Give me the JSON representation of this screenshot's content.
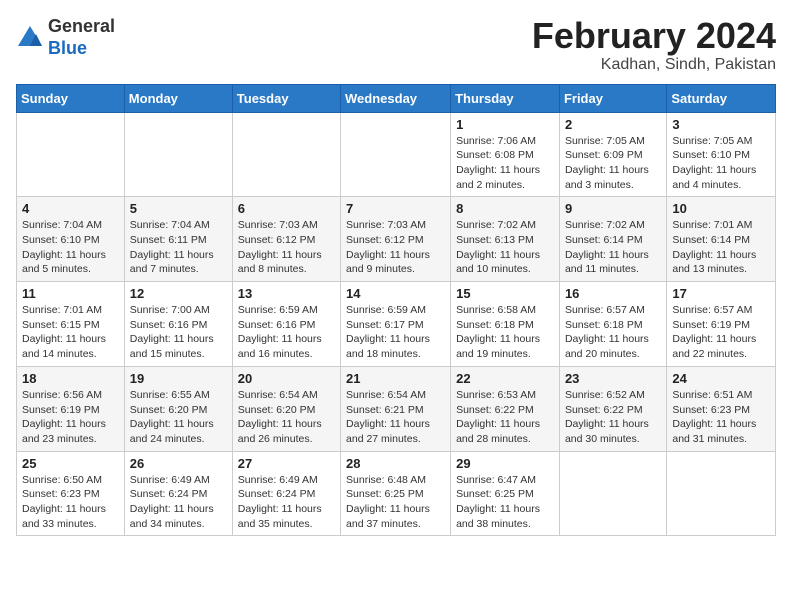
{
  "header": {
    "logo_general": "General",
    "logo_blue": "Blue",
    "month_title": "February 2024",
    "location": "Kadhan, Sindh, Pakistan"
  },
  "weekdays": [
    "Sunday",
    "Monday",
    "Tuesday",
    "Wednesday",
    "Thursday",
    "Friday",
    "Saturday"
  ],
  "weeks": [
    [
      {
        "day": "",
        "info": ""
      },
      {
        "day": "",
        "info": ""
      },
      {
        "day": "",
        "info": ""
      },
      {
        "day": "",
        "info": ""
      },
      {
        "day": "1",
        "info": "Sunrise: 7:06 AM\nSunset: 6:08 PM\nDaylight: 11 hours\nand 2 minutes."
      },
      {
        "day": "2",
        "info": "Sunrise: 7:05 AM\nSunset: 6:09 PM\nDaylight: 11 hours\nand 3 minutes."
      },
      {
        "day": "3",
        "info": "Sunrise: 7:05 AM\nSunset: 6:10 PM\nDaylight: 11 hours\nand 4 minutes."
      }
    ],
    [
      {
        "day": "4",
        "info": "Sunrise: 7:04 AM\nSunset: 6:10 PM\nDaylight: 11 hours\nand 5 minutes."
      },
      {
        "day": "5",
        "info": "Sunrise: 7:04 AM\nSunset: 6:11 PM\nDaylight: 11 hours\nand 7 minutes."
      },
      {
        "day": "6",
        "info": "Sunrise: 7:03 AM\nSunset: 6:12 PM\nDaylight: 11 hours\nand 8 minutes."
      },
      {
        "day": "7",
        "info": "Sunrise: 7:03 AM\nSunset: 6:12 PM\nDaylight: 11 hours\nand 9 minutes."
      },
      {
        "day": "8",
        "info": "Sunrise: 7:02 AM\nSunset: 6:13 PM\nDaylight: 11 hours\nand 10 minutes."
      },
      {
        "day": "9",
        "info": "Sunrise: 7:02 AM\nSunset: 6:14 PM\nDaylight: 11 hours\nand 11 minutes."
      },
      {
        "day": "10",
        "info": "Sunrise: 7:01 AM\nSunset: 6:14 PM\nDaylight: 11 hours\nand 13 minutes."
      }
    ],
    [
      {
        "day": "11",
        "info": "Sunrise: 7:01 AM\nSunset: 6:15 PM\nDaylight: 11 hours\nand 14 minutes."
      },
      {
        "day": "12",
        "info": "Sunrise: 7:00 AM\nSunset: 6:16 PM\nDaylight: 11 hours\nand 15 minutes."
      },
      {
        "day": "13",
        "info": "Sunrise: 6:59 AM\nSunset: 6:16 PM\nDaylight: 11 hours\nand 16 minutes."
      },
      {
        "day": "14",
        "info": "Sunrise: 6:59 AM\nSunset: 6:17 PM\nDaylight: 11 hours\nand 18 minutes."
      },
      {
        "day": "15",
        "info": "Sunrise: 6:58 AM\nSunset: 6:18 PM\nDaylight: 11 hours\nand 19 minutes."
      },
      {
        "day": "16",
        "info": "Sunrise: 6:57 AM\nSunset: 6:18 PM\nDaylight: 11 hours\nand 20 minutes."
      },
      {
        "day": "17",
        "info": "Sunrise: 6:57 AM\nSunset: 6:19 PM\nDaylight: 11 hours\nand 22 minutes."
      }
    ],
    [
      {
        "day": "18",
        "info": "Sunrise: 6:56 AM\nSunset: 6:19 PM\nDaylight: 11 hours\nand 23 minutes."
      },
      {
        "day": "19",
        "info": "Sunrise: 6:55 AM\nSunset: 6:20 PM\nDaylight: 11 hours\nand 24 minutes."
      },
      {
        "day": "20",
        "info": "Sunrise: 6:54 AM\nSunset: 6:20 PM\nDaylight: 11 hours\nand 26 minutes."
      },
      {
        "day": "21",
        "info": "Sunrise: 6:54 AM\nSunset: 6:21 PM\nDaylight: 11 hours\nand 27 minutes."
      },
      {
        "day": "22",
        "info": "Sunrise: 6:53 AM\nSunset: 6:22 PM\nDaylight: 11 hours\nand 28 minutes."
      },
      {
        "day": "23",
        "info": "Sunrise: 6:52 AM\nSunset: 6:22 PM\nDaylight: 11 hours\nand 30 minutes."
      },
      {
        "day": "24",
        "info": "Sunrise: 6:51 AM\nSunset: 6:23 PM\nDaylight: 11 hours\nand 31 minutes."
      }
    ],
    [
      {
        "day": "25",
        "info": "Sunrise: 6:50 AM\nSunset: 6:23 PM\nDaylight: 11 hours\nand 33 minutes."
      },
      {
        "day": "26",
        "info": "Sunrise: 6:49 AM\nSunset: 6:24 PM\nDaylight: 11 hours\nand 34 minutes."
      },
      {
        "day": "27",
        "info": "Sunrise: 6:49 AM\nSunset: 6:24 PM\nDaylight: 11 hours\nand 35 minutes."
      },
      {
        "day": "28",
        "info": "Sunrise: 6:48 AM\nSunset: 6:25 PM\nDaylight: 11 hours\nand 37 minutes."
      },
      {
        "day": "29",
        "info": "Sunrise: 6:47 AM\nSunset: 6:25 PM\nDaylight: 11 hours\nand 38 minutes."
      },
      {
        "day": "",
        "info": ""
      },
      {
        "day": "",
        "info": ""
      }
    ]
  ]
}
